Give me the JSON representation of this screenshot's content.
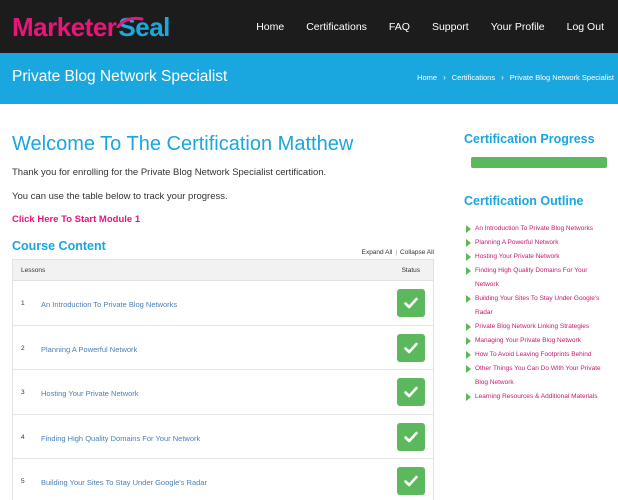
{
  "brand": {
    "name_part1": "Marketer",
    "name_part2": "Seal"
  },
  "nav": {
    "items": [
      "Home",
      "Certifications",
      "FAQ",
      "Support",
      "Your Profile",
      "Log Out"
    ]
  },
  "header": {
    "title": "Private Blog Network Specialist",
    "breadcrumb": [
      "Home",
      "Certifications",
      "Private Blog Network Specialist"
    ],
    "breadcrumb_sep": "›"
  },
  "main": {
    "welcome": "Welcome To The Certification Matthew",
    "intro": "Thank you for enrolling for the Private Blog Network Specialist certification.",
    "track": "You can use the table below to track your progress.",
    "start_link": "Click Here To Start Module 1",
    "course_content_title": "Course Content",
    "expand_all": "Expand All",
    "collapse_all": "Collapse All",
    "expand_sep": "|",
    "table": {
      "col_lessons": "Lessons",
      "col_status": "Status",
      "rows": [
        {
          "num": "1",
          "lesson": "An Introduction To Private Blog Networks",
          "status": "complete"
        },
        {
          "num": "2",
          "lesson": "Planning A Powerful Network",
          "status": "complete"
        },
        {
          "num": "3",
          "lesson": "Hosting Your Private Network",
          "status": "complete"
        },
        {
          "num": "4",
          "lesson": "Finding High Quality Domains For Your Network",
          "status": "complete"
        },
        {
          "num": "5",
          "lesson": "Building Your Sites To Stay Under Google's Radar",
          "status": "complete"
        }
      ]
    }
  },
  "sidebar": {
    "progress_title": "Certification Progress",
    "progress_fraction": 1.0,
    "outline_title": "Certification Outline",
    "outline_items": [
      "An Introduction To Private Blog Networks",
      "Planning A Powerful Network",
      "Hosting Your Private Network",
      "Finding High Quality Domains For Your Network",
      "Building Your Sites To Stay Under Google's Radar",
      "Private Blog Network Linking Strategies",
      "Managing Your Private Blog Network",
      "How To Avoid Leaving Footprints Behind",
      "Other Things You Can Do With Your Private Blog Network",
      "Learning Resources & Additional Materials"
    ]
  },
  "colors": {
    "brand_pink": "#e8157a",
    "brand_blue": "#1aa6de",
    "nav_bg": "#1c1c1c",
    "success_green": "#5cb85c",
    "lesson_link": "#4a7fb8",
    "outline_link": "#c8186e"
  },
  "icons": {
    "status_complete": "check-icon",
    "outline_bullet": "triangle-right-icon"
  }
}
